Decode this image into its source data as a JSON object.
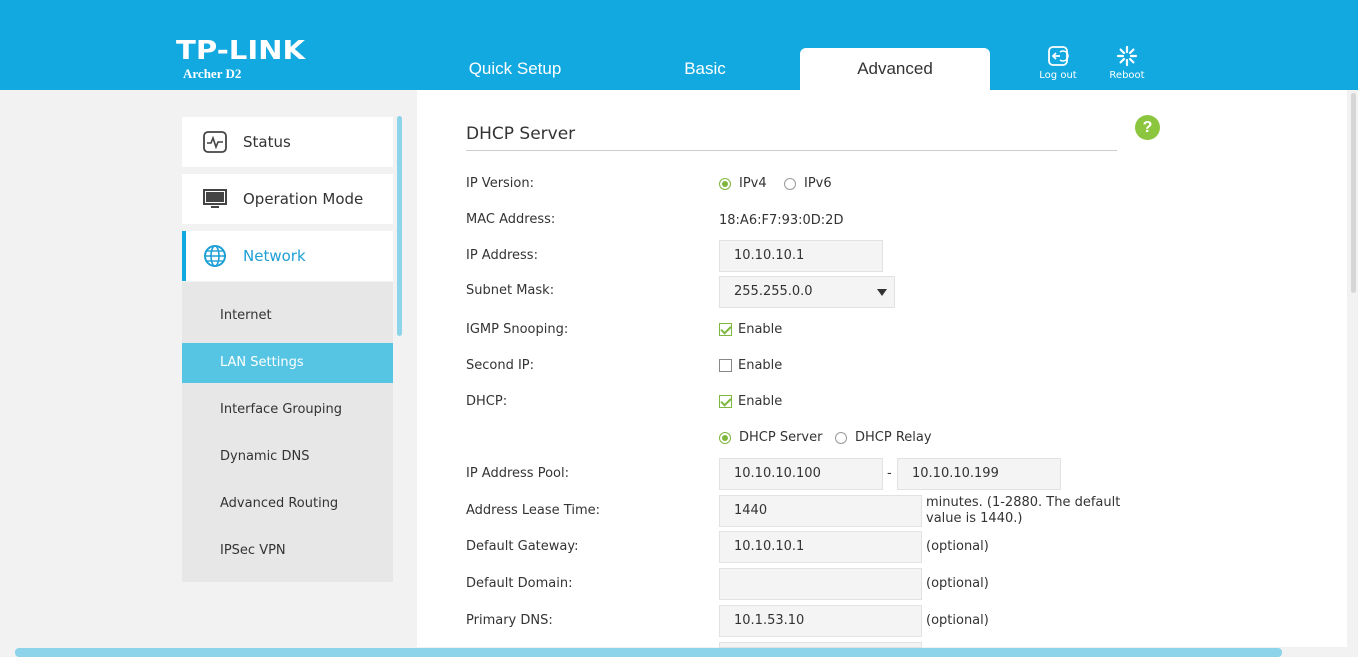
{
  "header": {
    "logo": "TP-LINK",
    "model": "Archer D2",
    "tabs": [
      {
        "label": "Quick Setup"
      },
      {
        "label": "Basic"
      },
      {
        "label": "Advanced"
      }
    ],
    "logout_label": "Log out",
    "reboot_label": "Reboot"
  },
  "sidebar": {
    "items": [
      {
        "label": "Status"
      },
      {
        "label": "Operation Mode"
      },
      {
        "label": "Network"
      }
    ],
    "subitems": [
      {
        "label": "Internet"
      },
      {
        "label": "LAN Settings"
      },
      {
        "label": "Interface Grouping"
      },
      {
        "label": "Dynamic DNS"
      },
      {
        "label": "Advanced Routing"
      },
      {
        "label": "IPSec VPN"
      }
    ]
  },
  "main": {
    "title": "DHCP Server",
    "help": "?",
    "labels": {
      "ip_version": "IP Version:",
      "mac_address": "MAC Address:",
      "ip_address": "IP Address:",
      "subnet_mask": "Subnet Mask:",
      "igmp_snooping": "IGMP Snooping:",
      "second_ip": "Second IP:",
      "dhcp": "DHCP:",
      "ip_pool": "IP Address Pool:",
      "lease_time": "Address Lease Time:",
      "default_gateway": "Default Gateway:",
      "default_domain": "Default Domain:",
      "primary_dns": "Primary DNS:"
    },
    "ip_version_options": {
      "ipv4": "IPv4",
      "ipv6": "IPv6"
    },
    "mac_value": "18:A6:F7:93:0D:2D",
    "ip_value": "10.10.10.1",
    "subnet_value": "255.255.0.0",
    "enable_label": "Enable",
    "dhcp_mode": {
      "server": "DHCP Server",
      "relay": "DHCP Relay"
    },
    "pool_start": "10.10.10.100",
    "pool_dash": "-",
    "pool_end": "10.10.10.199",
    "lease_value": "1440",
    "lease_note_1": "minutes. (1-2880. The default",
    "lease_note_2": "value is 1440.)",
    "gateway_value": "10.10.10.1",
    "domain_value": "",
    "dns_value": "10.1.53.10",
    "optional": "(optional)"
  },
  "colors": {
    "header": "#12a9e0",
    "active_sub": "#56c4e3",
    "green": "#7fb63d"
  }
}
